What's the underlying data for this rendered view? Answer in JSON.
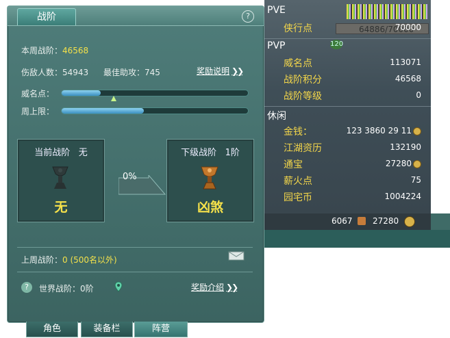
{
  "panel": {
    "title_tab": "战阶",
    "help_label": "?",
    "current_rank_label": "本周战阶：",
    "current_rank_value": "46568",
    "kills_text": "伤敌人数：54943",
    "assist_text": "最佳助攻：745",
    "reward_info_label": "奖励说明",
    "prestige_label": "威名点：",
    "weekly_cap_label": "周上限：",
    "prestige_fill": 0.21,
    "weekly_cap_fill": 0.44,
    "current_box": {
      "caption": "当前战阶",
      "caption_value": "无",
      "name": "无"
    },
    "progress_pct": "0%",
    "next_box": {
      "caption": "下级战阶",
      "caption_value": "1阶",
      "name": "凶煞"
    },
    "last_week_label": "上周战阶：",
    "last_week_value": "0 (500名以外)",
    "world_rank_label": "世界战阶：0阶",
    "reward_intro_label": "奖励介绍"
  },
  "bottom_tabs": [
    {
      "label": "角色"
    },
    {
      "label": "装备栏"
    },
    {
      "label": "阵营"
    }
  ],
  "stats": {
    "pve_header": "PVE",
    "pvp_header": "PVP",
    "leisure_header": "休闲",
    "rows": [
      {
        "label": "侠行点",
        "value": "70000"
      },
      {
        "label": "威名点",
        "value": "113071"
      },
      {
        "label": "战阶积分",
        "value": "46568"
      },
      {
        "label": "战阶等级",
        "value": "0"
      },
      {
        "label": "金钱：",
        "value": "123  3860  29  11"
      },
      {
        "label": "江湖资历",
        "value": "132190"
      },
      {
        "label": "通宝",
        "value": "27280"
      },
      {
        "label": "薪火点",
        "value": "75"
      },
      {
        "label": "园宅币",
        "value": "1004224"
      }
    ],
    "bg_text_hp": "64886/70000",
    "bg_level": "120",
    "footer_left": "6067",
    "footer_right": "27280"
  }
}
